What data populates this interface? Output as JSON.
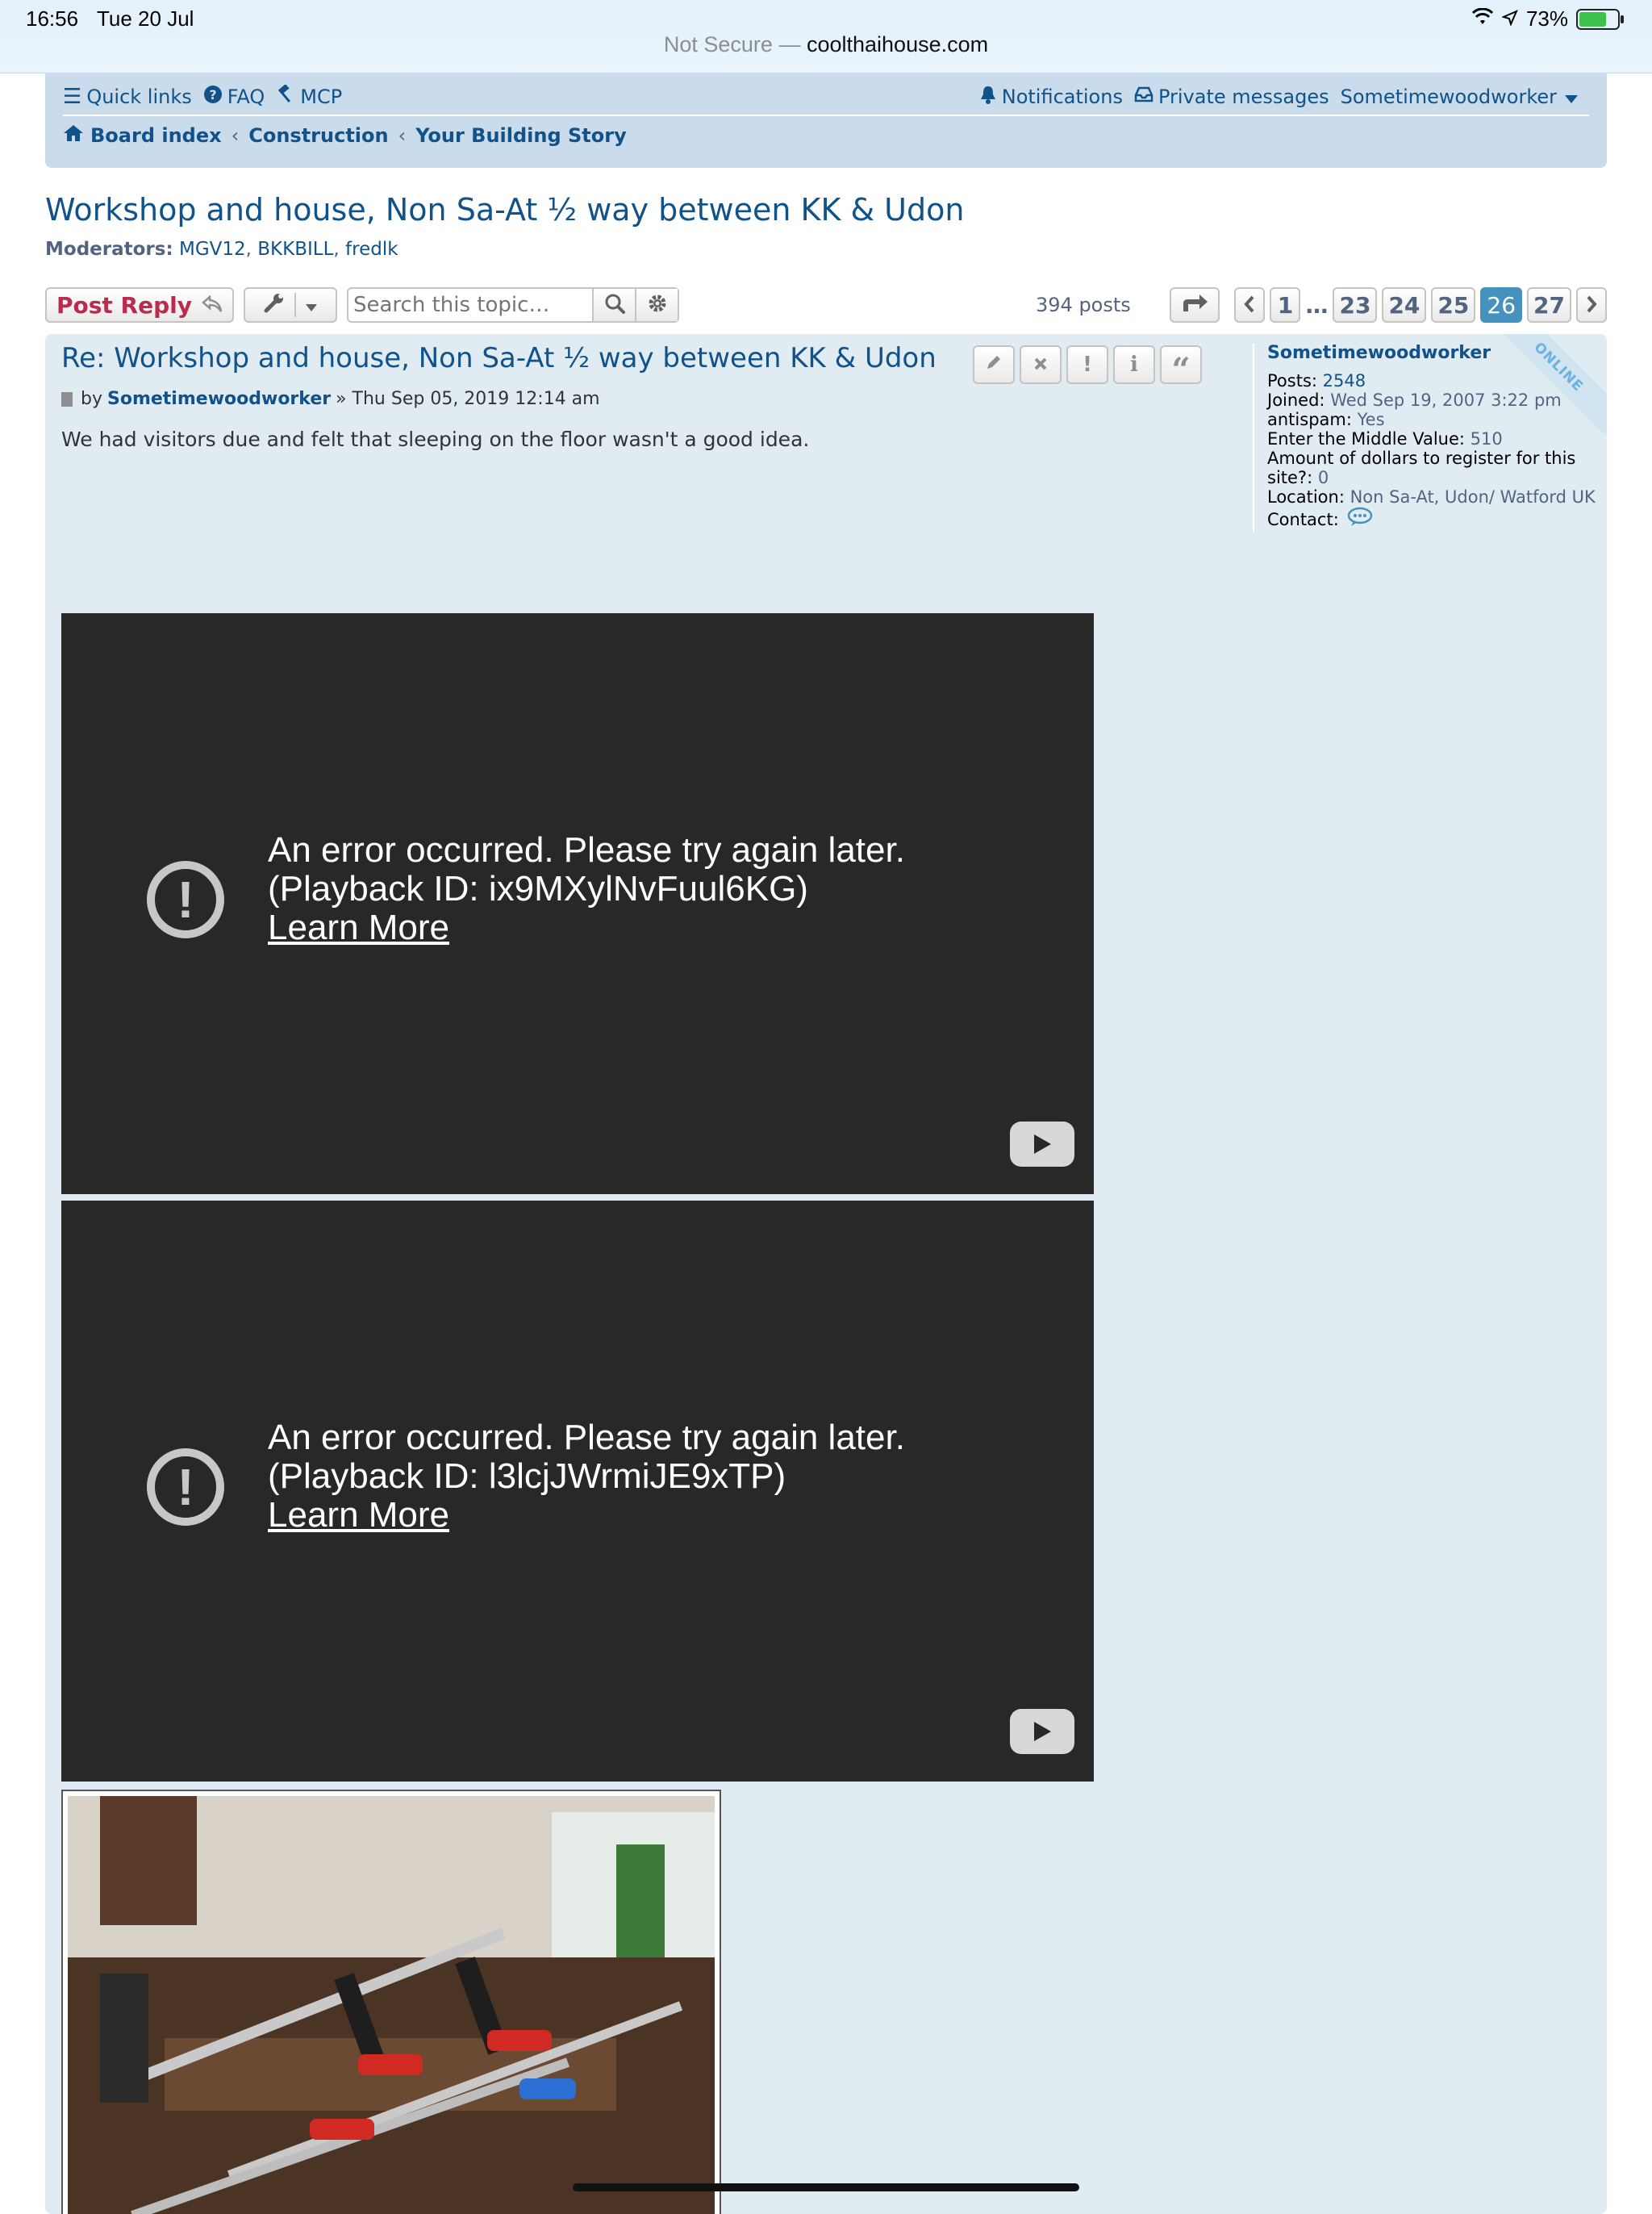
{
  "status": {
    "time": "16:56",
    "date": "Tue 20 Jul",
    "battery": "73%"
  },
  "browser": {
    "not_secure": "Not Secure —",
    "host": "coolthaihouse.com"
  },
  "nav": {
    "quick_links": "Quick links",
    "faq": "FAQ",
    "mcp": "MCP",
    "notifications": "Notifications",
    "private_messages": "Private messages",
    "user": "Sometimewoodworker",
    "breadcrumbs": [
      "Board index",
      "Construction",
      "Your Building Story"
    ]
  },
  "topic": {
    "title": "Workshop and house, Non Sa-At ½ way between KK & Udon",
    "moderators_label": "Moderators:",
    "moderators": [
      "MGV12",
      "BKKBILL",
      "fredlk"
    ]
  },
  "actions": {
    "post_reply": "Post Reply",
    "search_placeholder": "Search this topic…",
    "posts_count": "394 posts",
    "pages": [
      "1",
      "…",
      "23",
      "24",
      "25",
      "26",
      "27"
    ],
    "current_page": "26"
  },
  "post": {
    "title": "Re: Workshop and house, Non Sa-At ½ way between KK & Udon",
    "by": "by",
    "author": "Sometimewoodworker",
    "date": "» Thu Sep 05, 2019 12:14 am",
    "body": "We had visitors due and felt that sleeping on the floor wasn't a good idea.",
    "videos": [
      {
        "line1": "An error occurred. Please try again later.",
        "line2": "(Playback ID: ix9MXylNvFuul6KG)",
        "learn_more": "Learn More"
      },
      {
        "line1": "An error occurred. Please try again later.",
        "line2": "(Playback ID: l3lcjJWrmiJE9xTP)",
        "learn_more": "Learn More"
      }
    ]
  },
  "profile": {
    "username": "Sometimewoodworker",
    "online": "ONLINE",
    "posts_label": "Posts:",
    "posts": "2548",
    "joined_label": "Joined:",
    "joined": "Wed Sep 19, 2007 3:22 pm",
    "antispam_label": "antispam:",
    "antispam": "Yes",
    "middle_label": "Enter the Middle Value:",
    "middle": "510",
    "dollars_label": "Amount of dollars to register for this site?:",
    "dollars": "0",
    "location_label": "Location:",
    "location": "Non Sa-At, Udon/ Watford UK",
    "contact_label": "Contact:"
  },
  "colors": {
    "link": "#105289",
    "reply": "#bc2a4d",
    "active_page": "#4692bf",
    "post_bg": "#e1ebf2"
  }
}
